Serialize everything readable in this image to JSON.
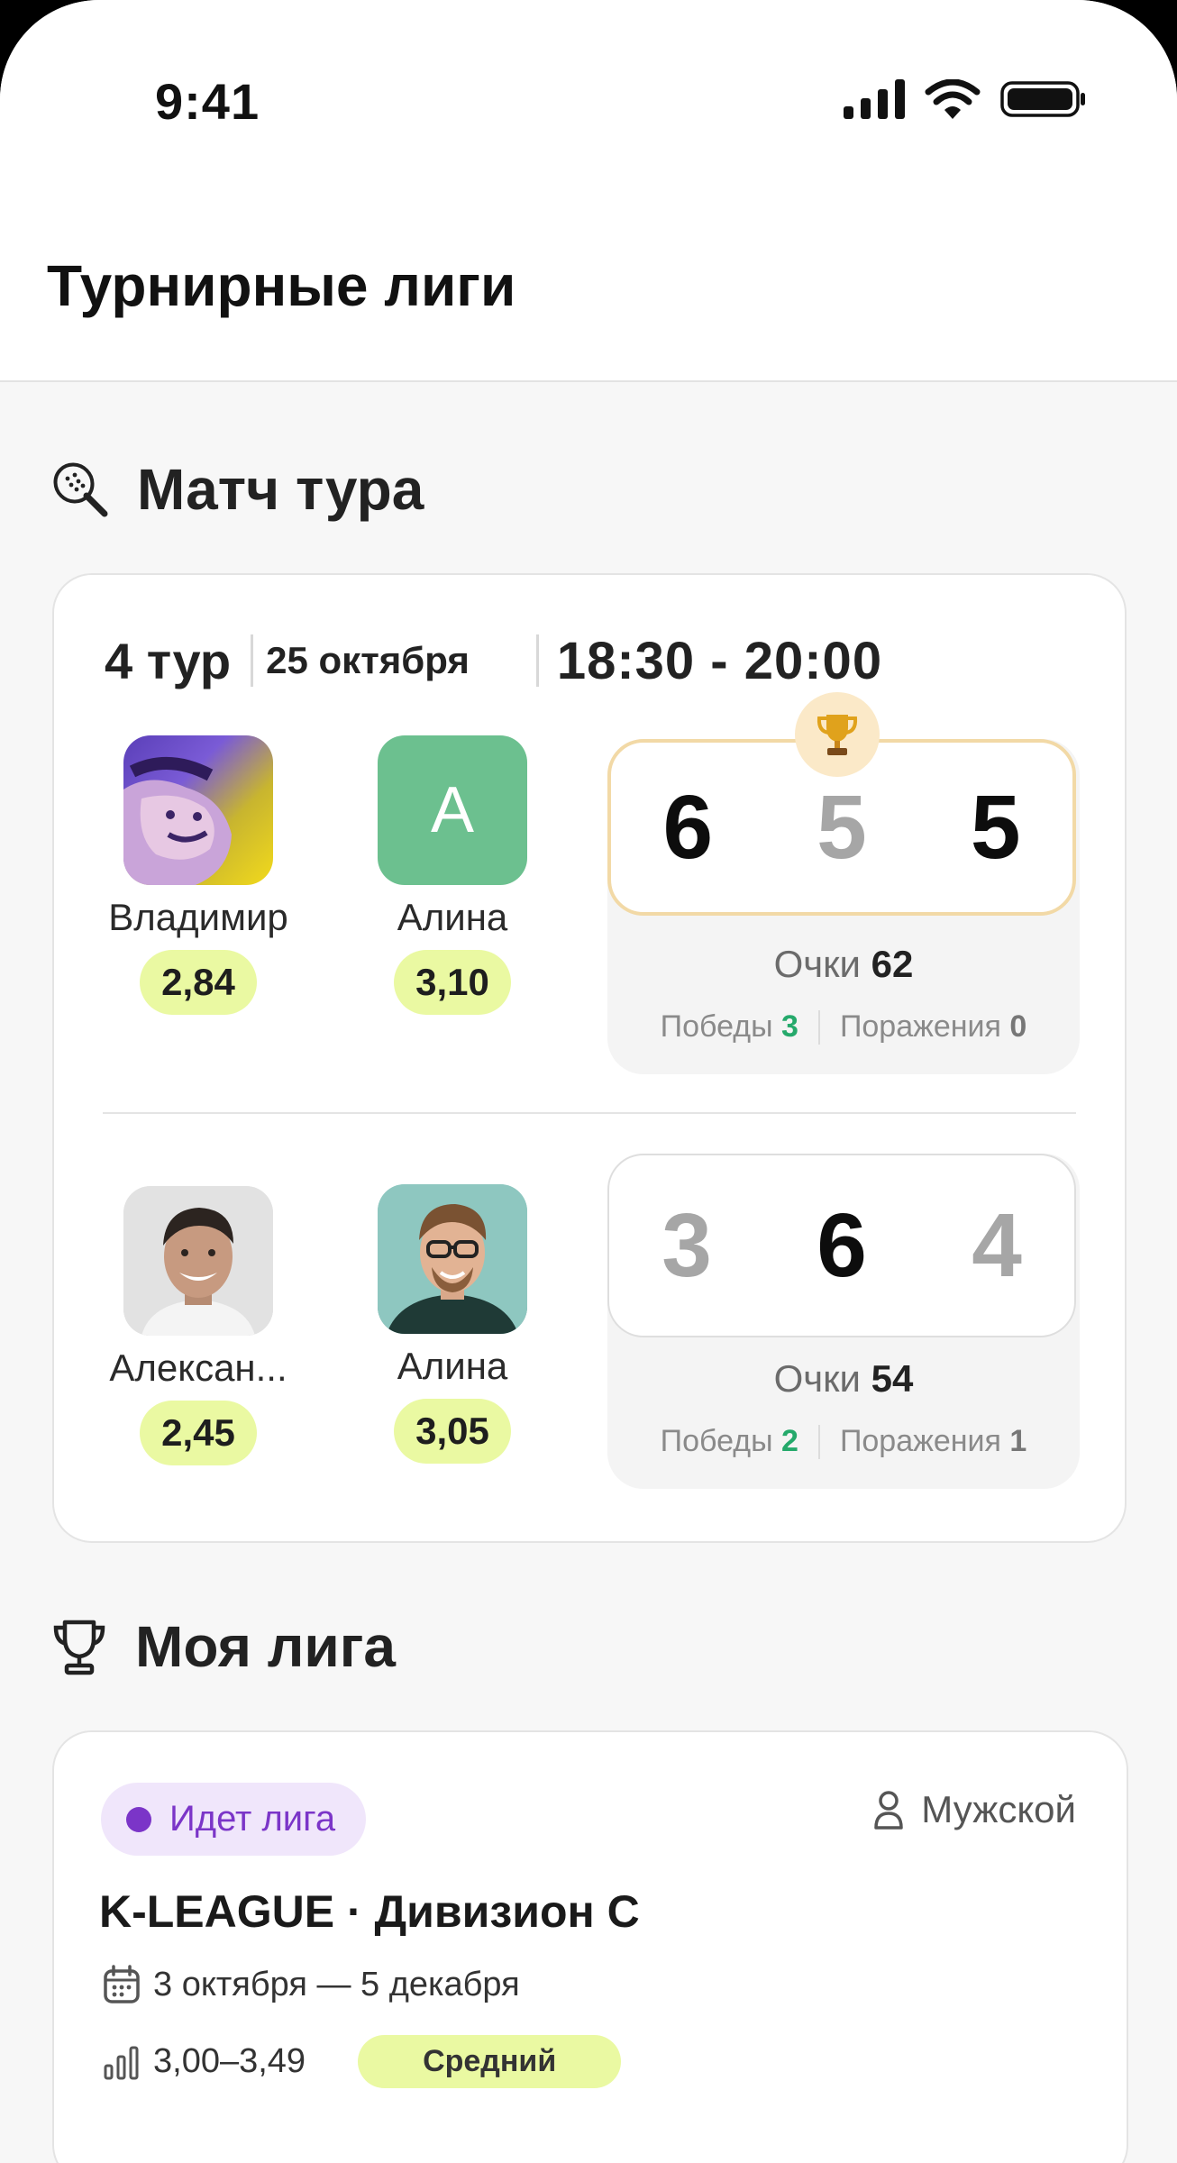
{
  "status_bar": {
    "time": "9:41"
  },
  "header": {
    "title": "Турнирные лиги"
  },
  "match_section": {
    "title": "Матч тура",
    "round": "4 тур",
    "date": "25 октября",
    "time": "18:30 - 20:00",
    "teams": [
      {
        "players": [
          {
            "name": "Владимир",
            "rating": "2,84"
          },
          {
            "name": "Алина",
            "rating": "3,10",
            "initial": "А"
          }
        ],
        "scores": [
          "6",
          "5",
          "5"
        ],
        "points_label": "Очки",
        "points": "62",
        "wins_label": "Победы",
        "wins": "3",
        "losses_label": "Поражения",
        "losses": "0"
      },
      {
        "players": [
          {
            "name": "Алексан...",
            "rating": "2,45"
          },
          {
            "name": "Алина",
            "rating": "3,05"
          }
        ],
        "scores": [
          "3",
          "6",
          "4"
        ],
        "points_label": "Очки",
        "points": "54",
        "wins_label": "Победы",
        "wins": "2",
        "losses_label": "Поражения",
        "losses": "1"
      }
    ]
  },
  "league_section": {
    "title": "Моя лига",
    "status": "Идет лига",
    "gender": "Мужской",
    "name": "K-LEAGUE · Дивизион C",
    "dates": "3 октября — 5 декабря",
    "rating_range": "3,00–3,49",
    "level": "Средний"
  },
  "colors": {
    "accent_lime": "#eaf9a2",
    "win_green": "#25a96b",
    "live_purple": "#7b35c8",
    "avatar_green": "#6cc08f"
  }
}
